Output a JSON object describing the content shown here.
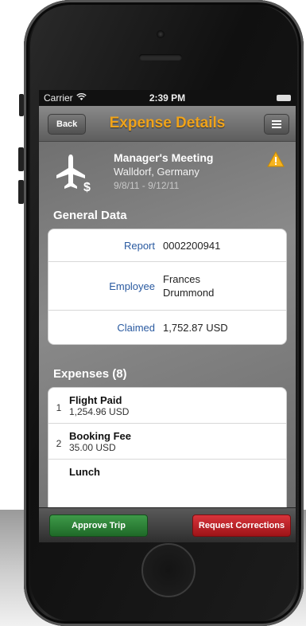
{
  "status_bar": {
    "carrier": "Carrier",
    "time": "2:39 PM"
  },
  "navbar": {
    "back_label": "Back",
    "title": "Expense Details",
    "menu_icon": "list-icon"
  },
  "trip": {
    "icon": "airplane-dollar-icon",
    "title": "Manager's Meeting",
    "location": "Walldorf, Germany",
    "dates": "9/8/11 - 9/12/11",
    "warning_icon": "warning-triangle-icon"
  },
  "general_data": {
    "heading": "General Data",
    "rows": [
      {
        "label": "Report",
        "value": "0002200941"
      },
      {
        "label": "Employee",
        "value": "Frances Drummond"
      },
      {
        "label": "Claimed",
        "value": "1,752.87 USD"
      }
    ]
  },
  "expenses": {
    "heading": "Expenses (8)",
    "items": [
      {
        "num": "1",
        "name": "Flight Paid",
        "amount": "1,254.96 USD"
      },
      {
        "num": "2",
        "name": "Booking Fee",
        "amount": "35.00 USD"
      },
      {
        "num": "",
        "name": "Lunch",
        "amount": ""
      }
    ]
  },
  "toolbar": {
    "approve_label": "Approve Trip",
    "corrections_label": "Request Corrections"
  },
  "colors": {
    "title_accent": "#f0a31a",
    "approve": "#2f8a3a",
    "corrections": "#c8252b",
    "link_blue": "#2a5aa0"
  }
}
